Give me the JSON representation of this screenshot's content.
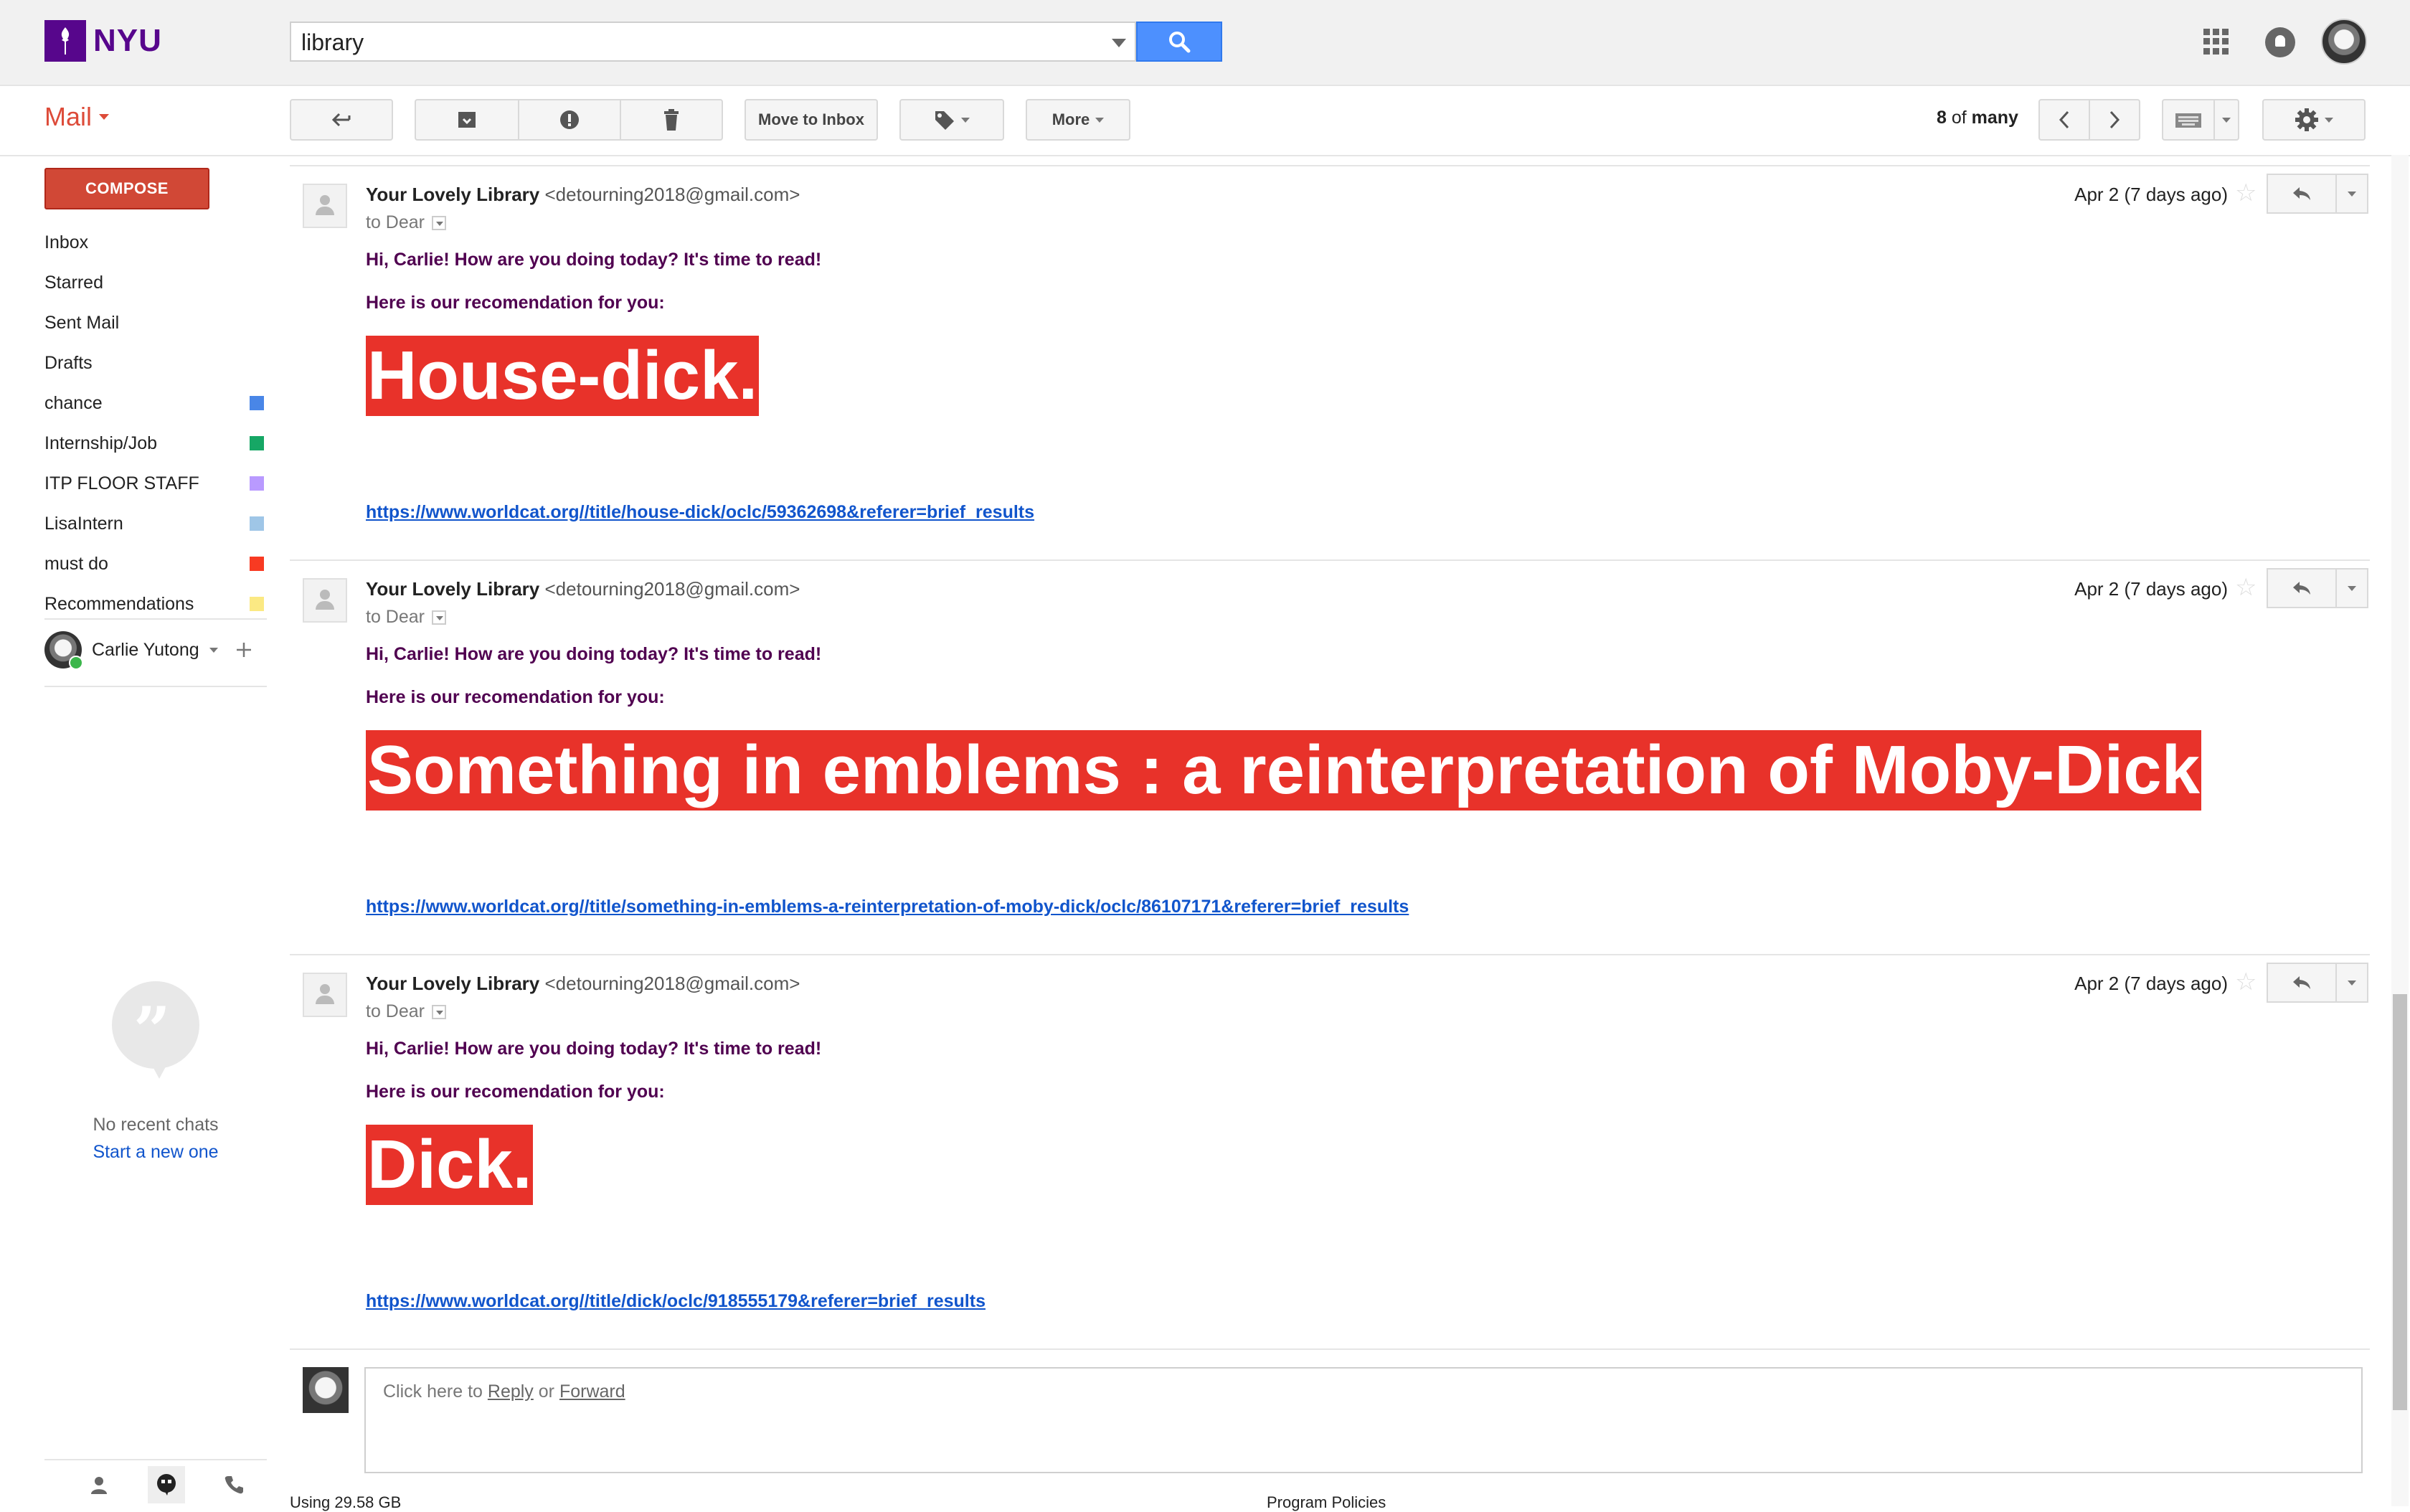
{
  "header": {
    "logo_text": "NYU",
    "search_value": "library",
    "icons": [
      "nyu-torch-icon",
      "search-icon",
      "apps-grid-icon",
      "notifications-icon",
      "account-avatar"
    ],
    "accent_color": "#4d90fe",
    "brand_color": "#57068c"
  },
  "toolbar": {
    "mail_label": "Mail",
    "move_to_inbox": "Move to Inbox",
    "more": "More",
    "pager_current": "8",
    "pager_of": " of ",
    "pager_total": "many",
    "icons": [
      "back-arrow-icon",
      "archive-icon",
      "spam-icon",
      "trash-icon",
      "label-tag-icon",
      "chevron-left-icon",
      "chevron-right-icon",
      "keyboard-icon",
      "gear-icon"
    ]
  },
  "sidebar": {
    "compose": "COMPOSE",
    "items": [
      {
        "label": "Inbox",
        "color": ""
      },
      {
        "label": "Starred",
        "color": ""
      },
      {
        "label": "Sent Mail",
        "color": ""
      },
      {
        "label": "Drafts",
        "color": ""
      },
      {
        "label": "chance",
        "color": "#4986e7"
      },
      {
        "label": "Internship/Job",
        "color": "#16a765"
      },
      {
        "label": "ITP FLOOR STAFF",
        "color": "#b99aff"
      },
      {
        "label": "LisaIntern",
        "color": "#9fc6e7"
      },
      {
        "label": "must do",
        "color": "#f83a22"
      },
      {
        "label": "Recommendations",
        "color": "#fbe983"
      }
    ],
    "chat_user": "Carlie Yutong",
    "no_recent_chats": "No recent chats",
    "start_new": "Start a new one"
  },
  "messages": [
    {
      "sender_name": "Your Lovely Library",
      "sender_email": "<detourning2018@gmail.com>",
      "to": "to Dear",
      "date": "Apr 2 (7 days ago)",
      "greeting": "Hi, Carlie! How are you doing today? It's time to read!",
      "intro": "Here is our recomendation for you:",
      "book_title": "House-dick.",
      "link": "https://www.worldcat.org//title/house-dick/oclc/59362698&referer=brief_results"
    },
    {
      "sender_name": "Your Lovely Library",
      "sender_email": "<detourning2018@gmail.com>",
      "to": "to Dear",
      "date": "Apr 2 (7 days ago)",
      "greeting": "Hi, Carlie! How are you doing today? It's time to read!",
      "intro": "Here is our recomendation for you:",
      "book_title": "Something in emblems : a reinterpretation of Moby-Dick",
      "link": "https://www.worldcat.org//title/something-in-emblems-a-reinterpretation-of-moby-dick/oclc/86107171&referer=brief_results"
    },
    {
      "sender_name": "Your Lovely Library",
      "sender_email": "<detourning2018@gmail.com>",
      "to": "to Dear",
      "date": "Apr 2 (7 days ago)",
      "greeting": "Hi, Carlie! How are you doing today? It's time to read!",
      "intro": "Here is our recomendation for you:",
      "book_title": "Dick.",
      "link": "https://www.worldcat.org//title/dick/oclc/918555179&referer=brief_results"
    }
  ],
  "reply": {
    "prefix": "Click here to ",
    "reply": "Reply",
    "or": " or ",
    "forward": "Forward"
  },
  "footer": {
    "left": "Using 29.58 GB",
    "right": "Program Policies"
  }
}
